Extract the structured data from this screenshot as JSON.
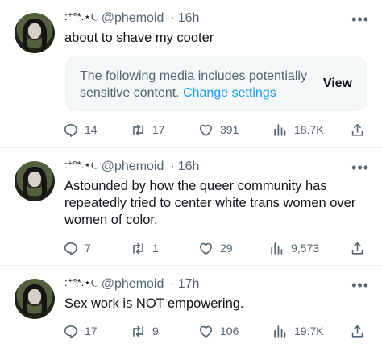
{
  "tweets": [
    {
      "handle_prefix": ":⁺°*.⋆⏾",
      "handle": "@phemoid",
      "separator": "·",
      "time": "16h",
      "text": "about to shave my cooter",
      "sensitive_media": {
        "message": "The following media includes potentially sensitive content.",
        "link": "Change settings",
        "button": "View"
      },
      "stats": {
        "replies": "14",
        "retweets": "17",
        "likes": "391",
        "views": "18.7K"
      }
    },
    {
      "handle_prefix": ":⁺°*.⋆⏾",
      "handle": "@phemoid",
      "separator": "·",
      "time": "16h",
      "text": "Astounded by how the queer community has repeatedly tried to center white trans women over women of color.",
      "stats": {
        "replies": "7",
        "retweets": "1",
        "likes": "29",
        "views": "9,573"
      }
    },
    {
      "handle_prefix": ":⁺°*.⋆⏾",
      "handle": "@phemoid",
      "separator": "·",
      "time": "17h",
      "text": "Sex work is NOT empowering.",
      "stats": {
        "replies": "17",
        "retweets": "9",
        "likes": "106",
        "views": "19.7K"
      }
    }
  ],
  "icons": {
    "reply": "reply-icon",
    "retweet": "retweet-icon",
    "like": "heart-icon",
    "views": "views-icon",
    "share": "share-icon",
    "more": "more-icon"
  },
  "colors": {
    "link": "#1d9bf0",
    "secondary_text": "#536471",
    "text": "#0f1419"
  }
}
